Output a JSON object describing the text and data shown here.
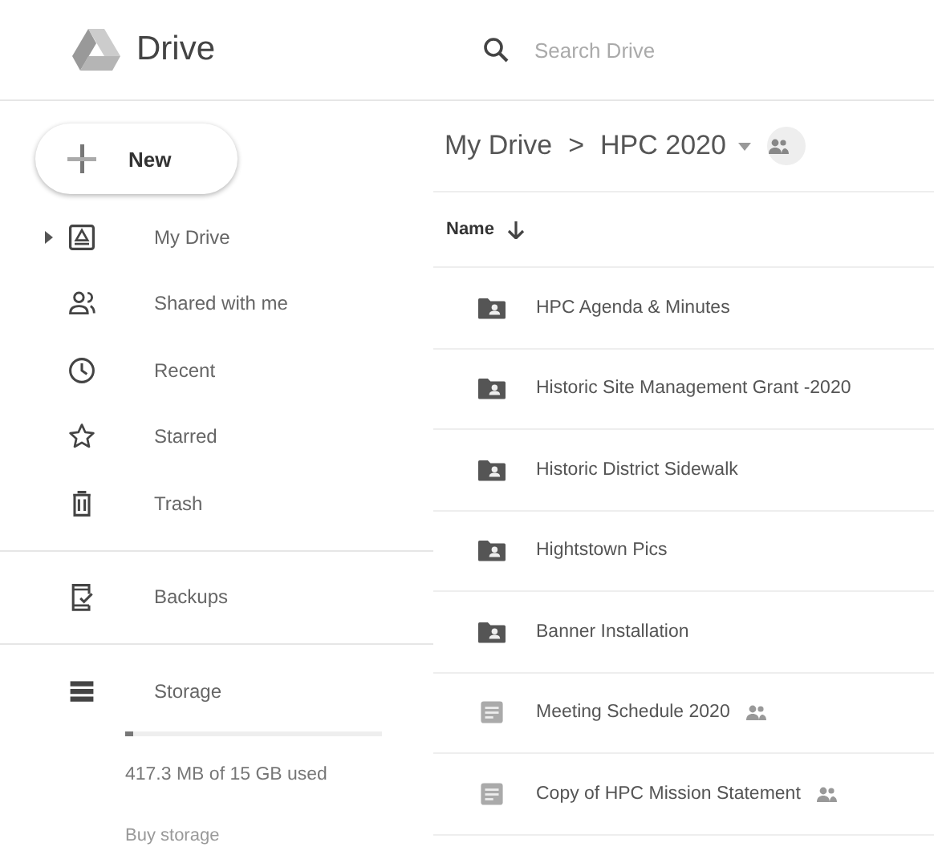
{
  "app": {
    "title": "Drive"
  },
  "search": {
    "placeholder": "Search Drive"
  },
  "new_button": {
    "label": "New"
  },
  "nav": [
    {
      "kind": "drive",
      "label": "My Drive",
      "expandable": true
    },
    {
      "kind": "shared",
      "label": "Shared with me",
      "expandable": false
    },
    {
      "kind": "recent",
      "label": "Recent",
      "expandable": false
    },
    {
      "kind": "starred",
      "label": "Starred",
      "expandable": false
    },
    {
      "kind": "trash",
      "label": "Trash",
      "expandable": false
    }
  ],
  "nav_secondary": [
    {
      "kind": "backups",
      "label": "Backups",
      "expandable": false
    }
  ],
  "storage": {
    "label": "Storage",
    "level": 0.03,
    "usage": "417.3 MB of 15 GB used",
    "buy_link": "Buy storage"
  },
  "breadcrumb": {
    "root": "My Drive",
    "separator": ">",
    "current": "HPC 2020"
  },
  "table": {
    "column": "Name",
    "rows": [
      {
        "kind": "shared-folder",
        "name": "HPC Agenda & Minutes",
        "shared": false
      },
      {
        "kind": "shared-folder",
        "name": "Historic Site Management Grant -2020",
        "shared": false
      },
      {
        "kind": "shared-folder",
        "name": "Historic District Sidewalk",
        "shared": false
      },
      {
        "kind": "shared-folder",
        "name": "Hightstown Pics",
        "shared": false
      },
      {
        "kind": "shared-folder",
        "name": "Banner Installation",
        "shared": false
      },
      {
        "kind": "form",
        "name": "Meeting Schedule 2020",
        "shared": true
      },
      {
        "kind": "form",
        "name": "Copy of HPC Mission Statement",
        "shared": true
      }
    ]
  }
}
